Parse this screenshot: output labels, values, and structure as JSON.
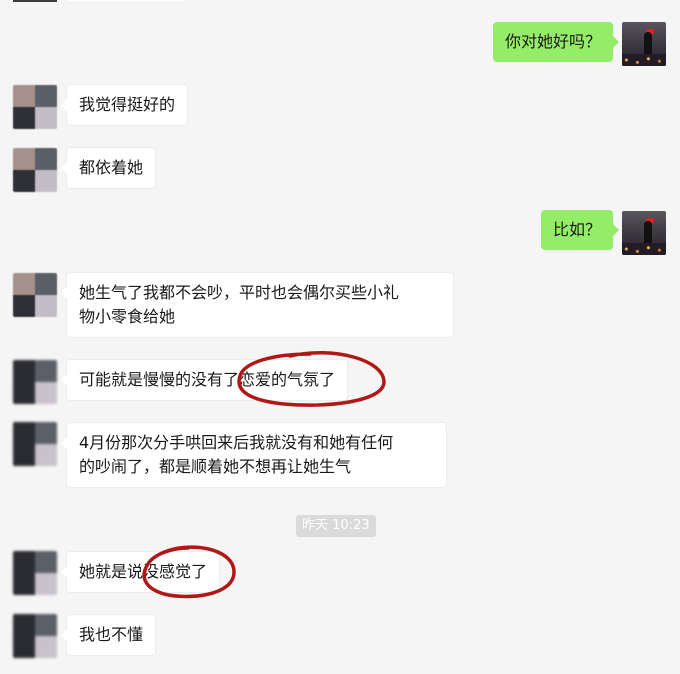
{
  "conversation": {
    "messages": [
      {
        "side": "right",
        "text": "你对她好吗？"
      },
      {
        "side": "left",
        "text": "我觉得挺好的"
      },
      {
        "side": "left",
        "text": "都依着她"
      },
      {
        "side": "right",
        "text": "比如？"
      },
      {
        "side": "left",
        "text": "她生气了我都不会吵，平时也会偶尔买些小礼\n物小零食给她"
      },
      {
        "side": "left",
        "text": "可能就是慢慢的没有了恋爱的气氛了"
      },
      {
        "side": "left",
        "text": "4月份那次分手哄回来后我就没有和她有任何\n的吵闹了，都是顺着她不想再让她生气"
      },
      {
        "side": "left",
        "text": "她就是说没感觉了"
      },
      {
        "side": "left",
        "text": "我也不懂"
      }
    ],
    "timestamp": "昨天 10:23"
  },
  "colors": {
    "background": "#f5f5f5",
    "incoming_bubble": "#ffffff",
    "outgoing_bubble": "#95ec69",
    "annotation_circle": "#b01818"
  },
  "icons": {
    "friend_avatar": "blurred-avatar-icon",
    "my_avatar": "night-city-avatar-icon"
  }
}
